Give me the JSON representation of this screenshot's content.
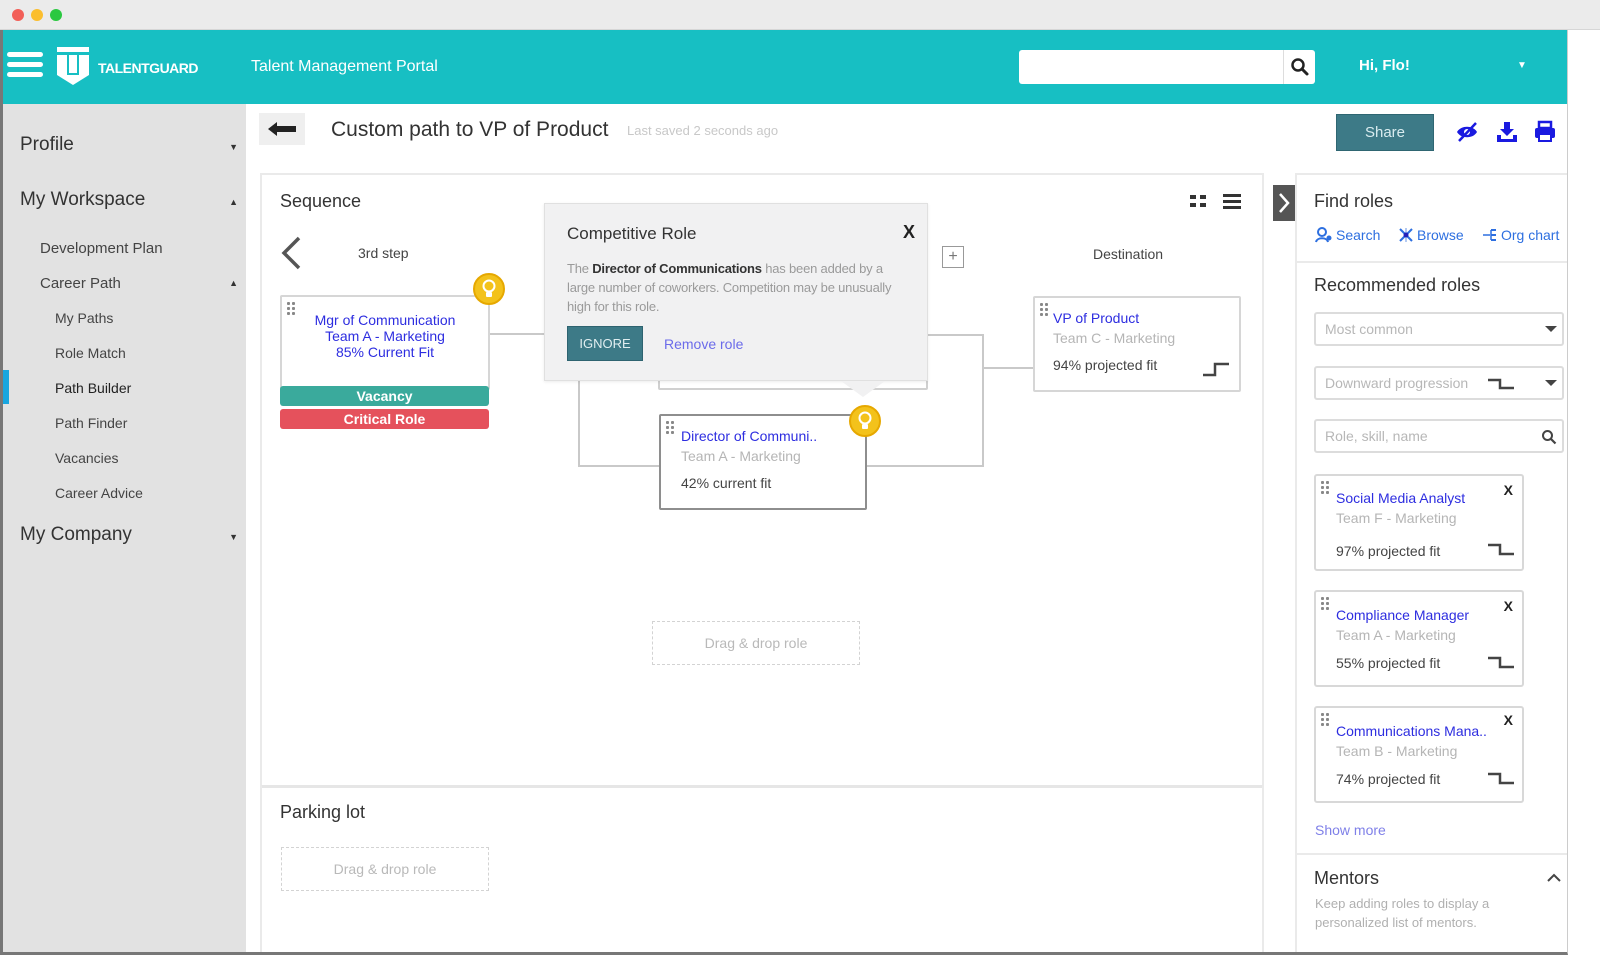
{
  "window": {
    "traffic_lights": [
      {
        "name": "close",
        "color": "#f25f58"
      },
      {
        "name": "minimize",
        "color": "#fbbe2e"
      },
      {
        "name": "zoom",
        "color": "#2ac840"
      }
    ]
  },
  "header": {
    "logo_text": "TALENTGUARD",
    "portal_title": "Talent Management Portal",
    "search_placeholder": "",
    "search_value": "",
    "greeting": "Hi, Flo!",
    "brand_color": "#17bfc3"
  },
  "sidebar": {
    "items": [
      {
        "label": "Profile",
        "level": 1,
        "caret": "▼"
      },
      {
        "label": "My Workspace",
        "level": 1,
        "caret": "▲"
      },
      {
        "label": "Development Plan",
        "level": 2
      },
      {
        "label": "Career Path",
        "level": 2,
        "caret": "▲"
      },
      {
        "label": "My Paths",
        "level": 3
      },
      {
        "label": "Role Match",
        "level": 3
      },
      {
        "label": "Path Builder",
        "level": 3,
        "active": true
      },
      {
        "label": "Path Finder",
        "level": 3
      },
      {
        "label": "Vacancies",
        "level": 3
      },
      {
        "label": "Career Advice",
        "level": 3
      },
      {
        "label": "My Company",
        "level": 1,
        "caret": "▼"
      }
    ]
  },
  "page": {
    "title": "Custom path to VP of Product",
    "saved_status": "Last saved 2 seconds ago",
    "share_label": "Share",
    "toolbar_icons": [
      "hide-icon",
      "download-icon",
      "print-icon"
    ]
  },
  "sequence": {
    "title": "Sequence",
    "step_label": "3rd step",
    "destination_label": "Destination",
    "current_role": {
      "name": "Mgr of Communication",
      "team": "Team A - Marketing",
      "fit": "85% Current Fit",
      "badges": [
        {
          "label": "Vacancy",
          "color": "#3aaa9c"
        },
        {
          "label": "Critical Role",
          "color": "#e5515c"
        }
      ]
    },
    "added_role": {
      "name": "Director of Communi..",
      "team": "Team A - Marketing",
      "fit": "42% current fit"
    },
    "destination_role": {
      "name": "VP of Product",
      "team": "Team C - Marketing",
      "fit": "94% projected fit"
    },
    "dropzone_label": "Drag & drop role"
  },
  "popup": {
    "title": "Competitive Role",
    "close_label": "X",
    "body_prefix": "The ",
    "body_bold": "Director of Communications",
    "body_suffix": " has been added by a large number of coworkers. Competition may be unusually high for this role.",
    "ignore_label": "IGNORE",
    "remove_label": "Remove role"
  },
  "parking_lot": {
    "title": "Parking lot",
    "dropzone_label": "Drag & drop role"
  },
  "right_panel": {
    "find_title": "Find roles",
    "links": [
      {
        "label": "Search",
        "icon": "person-search-icon"
      },
      {
        "label": "Browse",
        "icon": "browse-icon"
      },
      {
        "label": "Org chart",
        "icon": "org-chart-icon"
      }
    ],
    "recommended_title": "Recommended roles",
    "sort_select": "Most common",
    "progression_select": "Downward progression",
    "filter_placeholder": "Role, skill, name",
    "recommended": [
      {
        "name": "Social Media Analyst",
        "team": "Team F - Marketing",
        "fit": "97% projected fit"
      },
      {
        "name": "Compliance Manager",
        "team": "Team A - Marketing",
        "fit": "55% projected fit"
      },
      {
        "name": "Communications Mana..",
        "team": "Team B - Marketing",
        "fit": "74% projected fit"
      }
    ],
    "close_label": "X",
    "show_more": "Show more",
    "mentors_title": "Mentors",
    "mentors_desc": "Keep adding roles to display a personalized list of mentors."
  }
}
